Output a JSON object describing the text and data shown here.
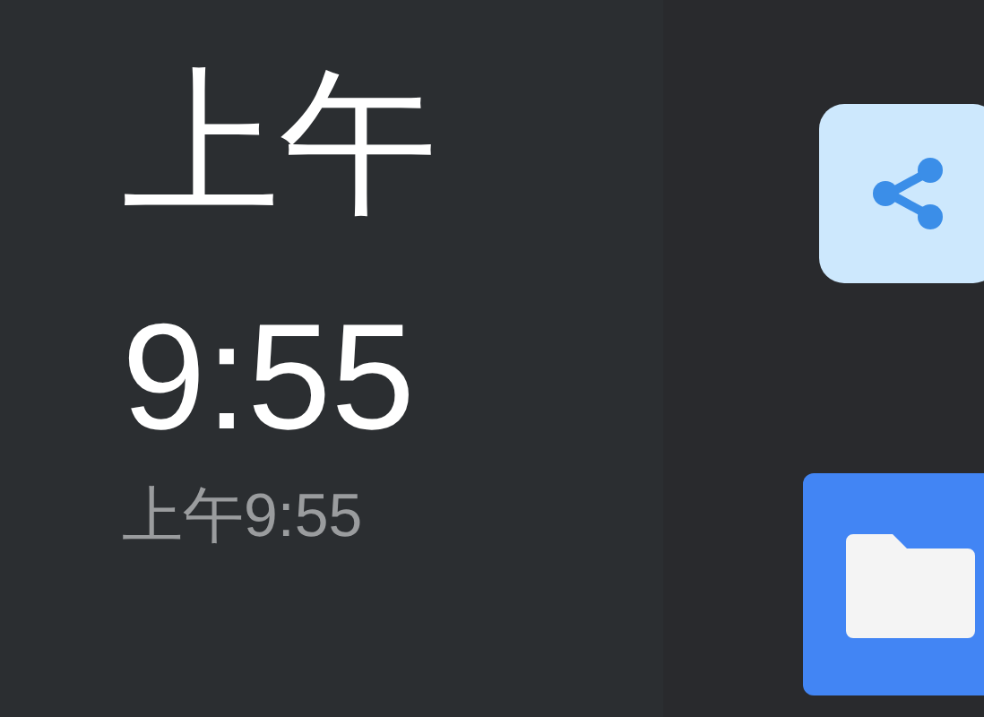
{
  "clock": {
    "period": "上午",
    "time": "9:55",
    "summary": "上午9:55"
  },
  "apps": [
    {
      "kind": "share"
    },
    {
      "kind": "folder"
    }
  ]
}
